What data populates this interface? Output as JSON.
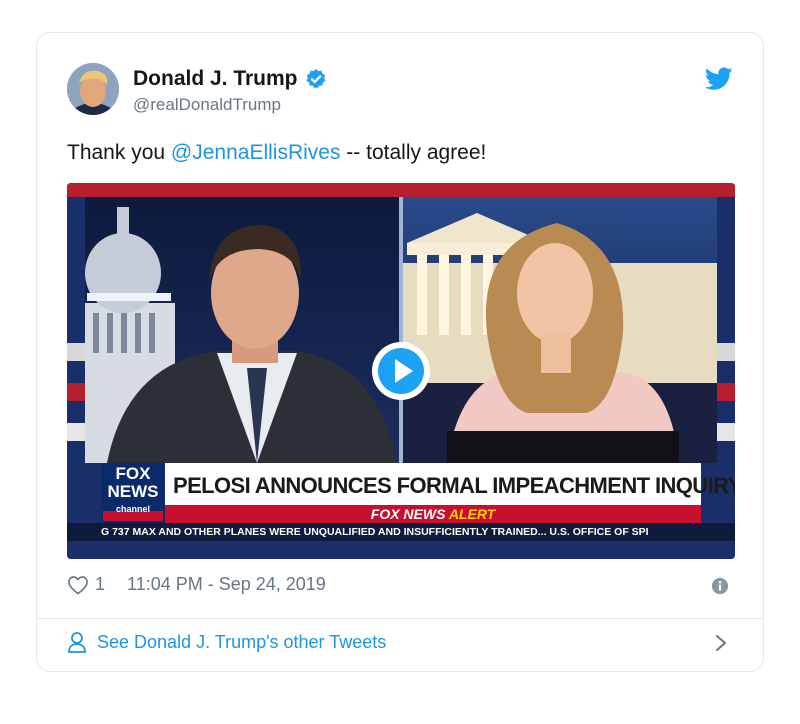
{
  "tweet": {
    "author_name": "Donald J. Trump",
    "author_handle": "@realDonaldTrump",
    "text_before": "Thank you ",
    "mention": "@JennaEllisRives",
    "text_after": " -- totally agree!",
    "like_count": "1",
    "timestamp": "11:04 PM - Sep 24, 2019",
    "footer_link": "See Donald J. Trump's other Tweets"
  },
  "video": {
    "network_logo_line1": "FOX",
    "network_logo_line2": "NEWS",
    "network_logo_line3": "channel",
    "headline": "PELOSI ANNOUNCES FORMAL IMPEACHMENT INQUIRY",
    "alert_brand": "FOX NEWS",
    "alert_word": "ALERT",
    "ticker": "G 737 MAX AND OTHER PLANES WERE UNQUALIFIED AND INSUFFICIENTLY TRAINED...   U.S. OFFICE OF SPI"
  },
  "colors": {
    "link": "#1b95e0",
    "text": "#14171a",
    "muted": "#657786",
    "border": "#e1e8ed",
    "fox_red": "#c8102e",
    "fox_blue": "#0a2a6b",
    "alert_yellow": "#ffd200"
  },
  "icons": [
    "verified-badge-icon",
    "twitter-bird-icon",
    "heart-icon",
    "info-icon",
    "user-icon",
    "chevron-right-icon",
    "play-icon"
  ]
}
